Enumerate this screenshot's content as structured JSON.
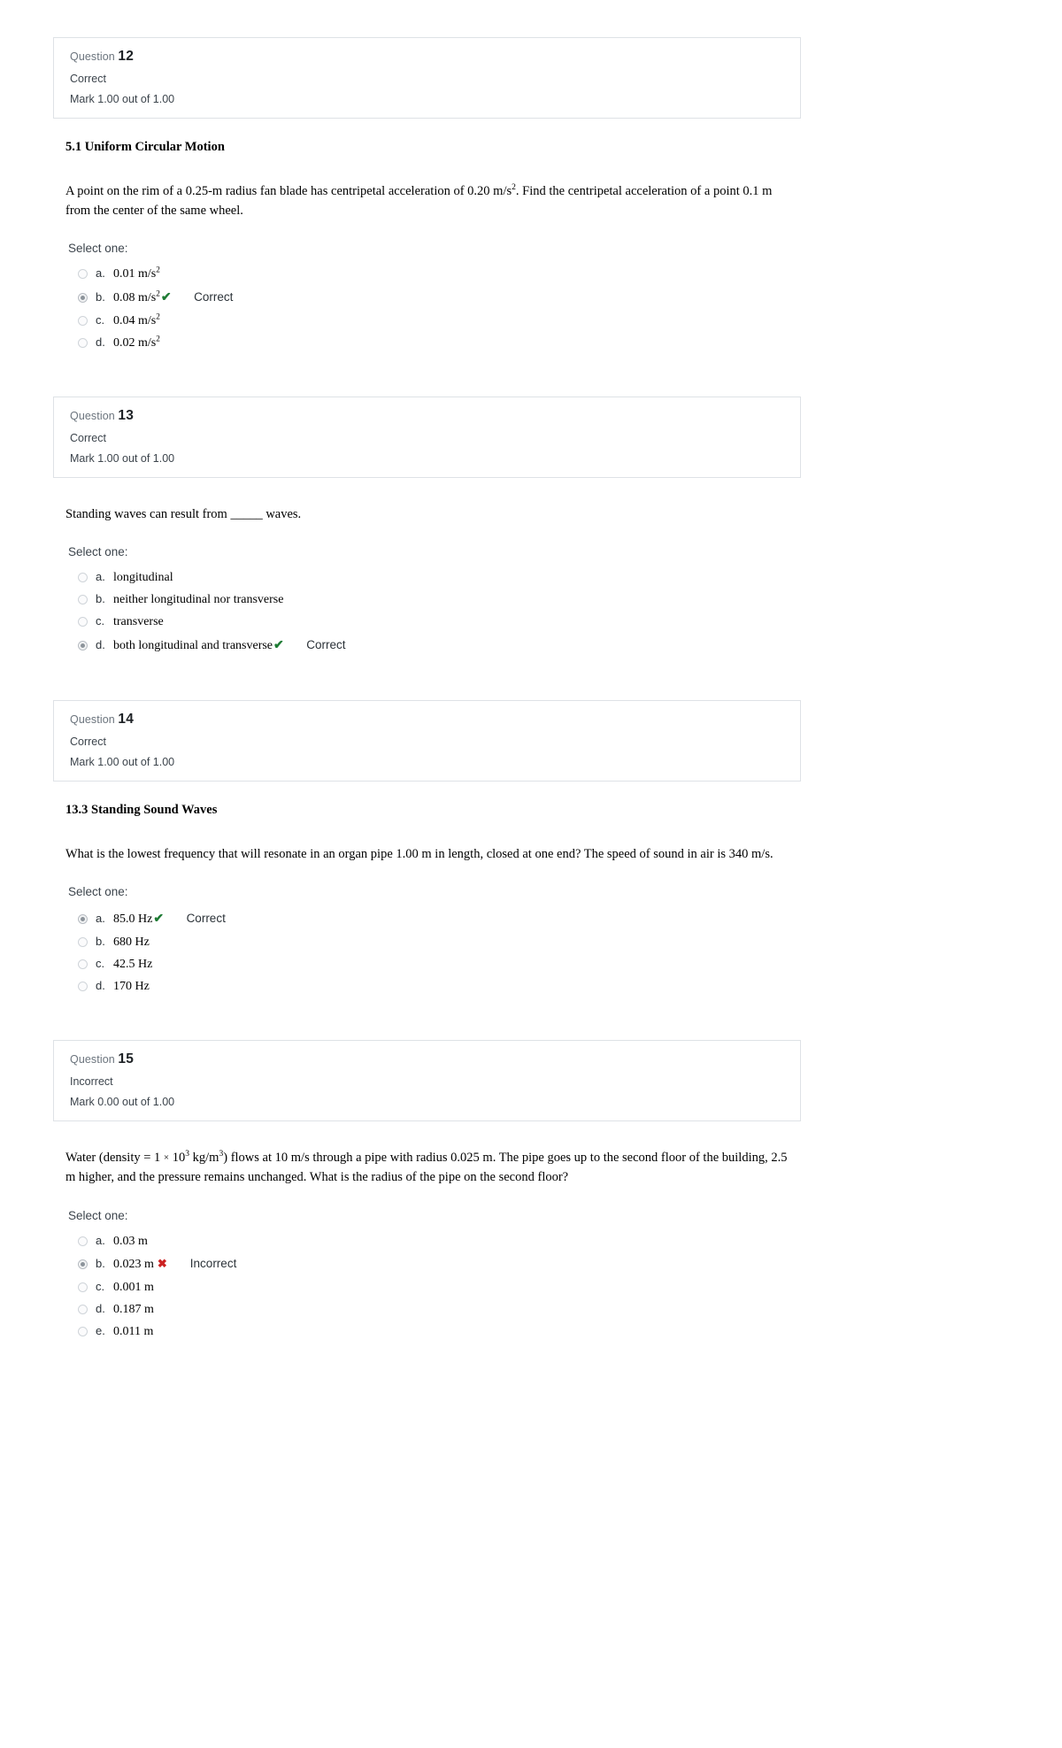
{
  "labels": {
    "question_word": "Question",
    "select_one": "Select one:"
  },
  "questions": [
    {
      "number": "12",
      "state": "Correct",
      "grade": "Mark 1.00 out of 1.00",
      "section_title": "5.1 Uniform Circular Motion",
      "text_html": "A point on the rim of a 0.25-m radius fan blade has centripetal acceleration of 0.20 m/s<sup>2</sup>. Find the centripetal acceleration of a point 0.1 m from the center of the same wheel.",
      "has_section_title": true,
      "options": [
        {
          "letter": "a.",
          "text_html": "0.01 m/s<sup>2</sup>",
          "selected": false,
          "mark": "",
          "feedback": ""
        },
        {
          "letter": "b.",
          "text_html": "0.08 m/s<sup>2</sup>",
          "selected": true,
          "mark": "correct",
          "feedback": "Correct"
        },
        {
          "letter": "c.",
          "text_html": "0.04 m/s<sup>2</sup>",
          "selected": false,
          "mark": "",
          "feedback": ""
        },
        {
          "letter": "d.",
          "text_html": "0.02 m/s<sup>2</sup>",
          "selected": false,
          "mark": "",
          "feedback": ""
        }
      ]
    },
    {
      "number": "13",
      "state": "Correct",
      "grade": "Mark 1.00 out of 1.00",
      "section_title": "",
      "text_html": "Standing waves can result from _____ waves.",
      "has_section_title": false,
      "options": [
        {
          "letter": "a.",
          "text_html": "longitudinal",
          "selected": false,
          "mark": "",
          "feedback": ""
        },
        {
          "letter": "b.",
          "text_html": "neither longitudinal nor transverse",
          "selected": false,
          "mark": "",
          "feedback": ""
        },
        {
          "letter": "c.",
          "text_html": "transverse",
          "selected": false,
          "mark": "",
          "feedback": ""
        },
        {
          "letter": "d.",
          "text_html": "both longitudinal and transverse",
          "selected": true,
          "mark": "correct",
          "feedback": "Correct"
        }
      ]
    },
    {
      "number": "14",
      "state": "Correct",
      "grade": "Mark 1.00 out of 1.00",
      "section_title": "13.3 Standing Sound Waves",
      "text_html": "What is the lowest frequency that will resonate in an organ pipe 1.00 m in length, closed at one end? The speed of sound in air is 340 m/s.",
      "has_section_title": true,
      "options": [
        {
          "letter": "a.",
          "text_html": "85.0 Hz",
          "selected": true,
          "mark": "correct",
          "feedback": "Correct"
        },
        {
          "letter": "b.",
          "text_html": "680 Hz",
          "selected": false,
          "mark": "",
          "feedback": ""
        },
        {
          "letter": "c.",
          "text_html": "42.5 Hz",
          "selected": false,
          "mark": "",
          "feedback": ""
        },
        {
          "letter": "d.",
          "text_html": "170 Hz",
          "selected": false,
          "mark": "",
          "feedback": ""
        }
      ]
    },
    {
      "number": "15",
      "state": "Incorrect",
      "grade": "Mark 0.00 out of 1.00",
      "section_title": "",
      "text_html": "Water (density = 1 <span class=\"times\">&#215;</span> 10<sup>3</sup> kg/m<sup>3</sup>) flows at 10 m/s through a pipe with radius 0.025 m. The pipe goes up to the second floor of the building, 2.5 m higher, and the pressure remains unchanged. What is the radius of the pipe on the second floor?",
      "has_section_title": false,
      "options": [
        {
          "letter": "a.",
          "text_html": "0.03 m",
          "selected": false,
          "mark": "",
          "feedback": ""
        },
        {
          "letter": "b.",
          "text_html": "0.023 m",
          "selected": true,
          "mark": "incorrect",
          "feedback": "Incorrect"
        },
        {
          "letter": "c.",
          "text_html": "0.001 m",
          "selected": false,
          "mark": "",
          "feedback": ""
        },
        {
          "letter": "d.",
          "text_html": "0.187 m",
          "selected": false,
          "mark": "",
          "feedback": ""
        },
        {
          "letter": "e.",
          "text_html": "0.011 m",
          "selected": false,
          "mark": "",
          "feedback": ""
        }
      ]
    }
  ],
  "icons": {
    "correct_glyph": "✔",
    "incorrect_glyph": "✖"
  },
  "colors": {
    "correct": "#1e7b34",
    "incorrect": "#cc2222",
    "border": "#dee2e6"
  }
}
